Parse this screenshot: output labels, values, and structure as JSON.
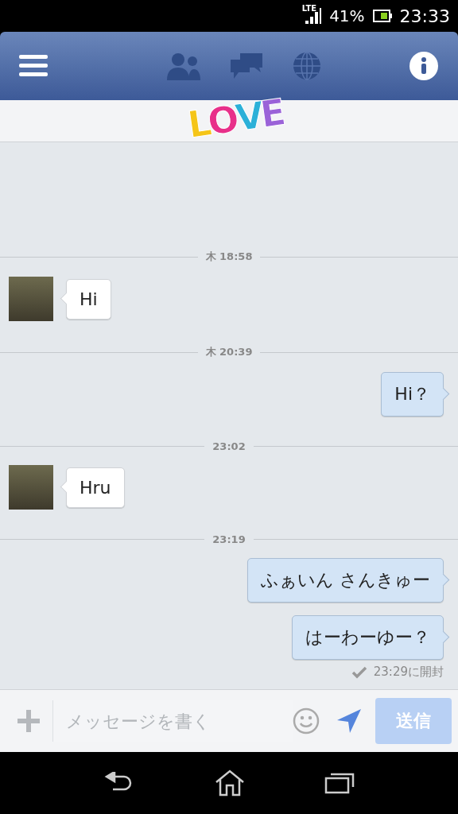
{
  "status_bar": {
    "network": "LTE",
    "battery": "41%",
    "time": "23:33"
  },
  "title": {
    "sticker": "LOVE"
  },
  "messages": [
    {
      "kind": "divider",
      "text": "木 18:58"
    },
    {
      "kind": "incoming",
      "text": "Hi"
    },
    {
      "kind": "divider",
      "text": "木 20:39"
    },
    {
      "kind": "outgoing",
      "text": "Hi？"
    },
    {
      "kind": "divider",
      "text": "23:02"
    },
    {
      "kind": "incoming",
      "text": "Hru"
    },
    {
      "kind": "divider",
      "text": "23:19"
    },
    {
      "kind": "outgoing",
      "text": "ふぁいん さんきゅー"
    },
    {
      "kind": "outgoing",
      "text": "はーわーゆー？"
    },
    {
      "kind": "receipt",
      "text": "23:29に開封"
    }
  ],
  "composer": {
    "placeholder": "メッセージを書く",
    "send": {
      "label": "送信",
      "disabled": true
    }
  }
}
